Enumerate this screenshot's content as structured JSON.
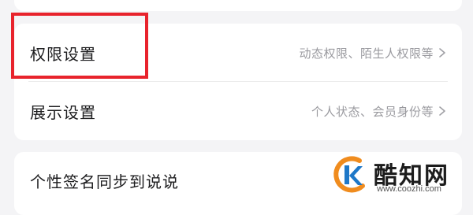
{
  "settings": {
    "rows": [
      {
        "label": "权限设置",
        "subtitle": "动态权限、陌生人权限等"
      },
      {
        "label": "展示设置",
        "subtitle": "个人状态、会员身份等"
      }
    ],
    "signature_sync": {
      "label": "个性签名同步到说说"
    }
  },
  "annotation": {
    "highlight_color": "#e8232c"
  },
  "watermark": {
    "title": "酷知网",
    "url": "www.coozhi.com",
    "colors": {
      "orange": "#f08c1e",
      "blue": "#1e78c8"
    }
  },
  "icons": {
    "chevron": "chevron-right-icon",
    "watermark_logo": "coozhi-logo-icon"
  }
}
